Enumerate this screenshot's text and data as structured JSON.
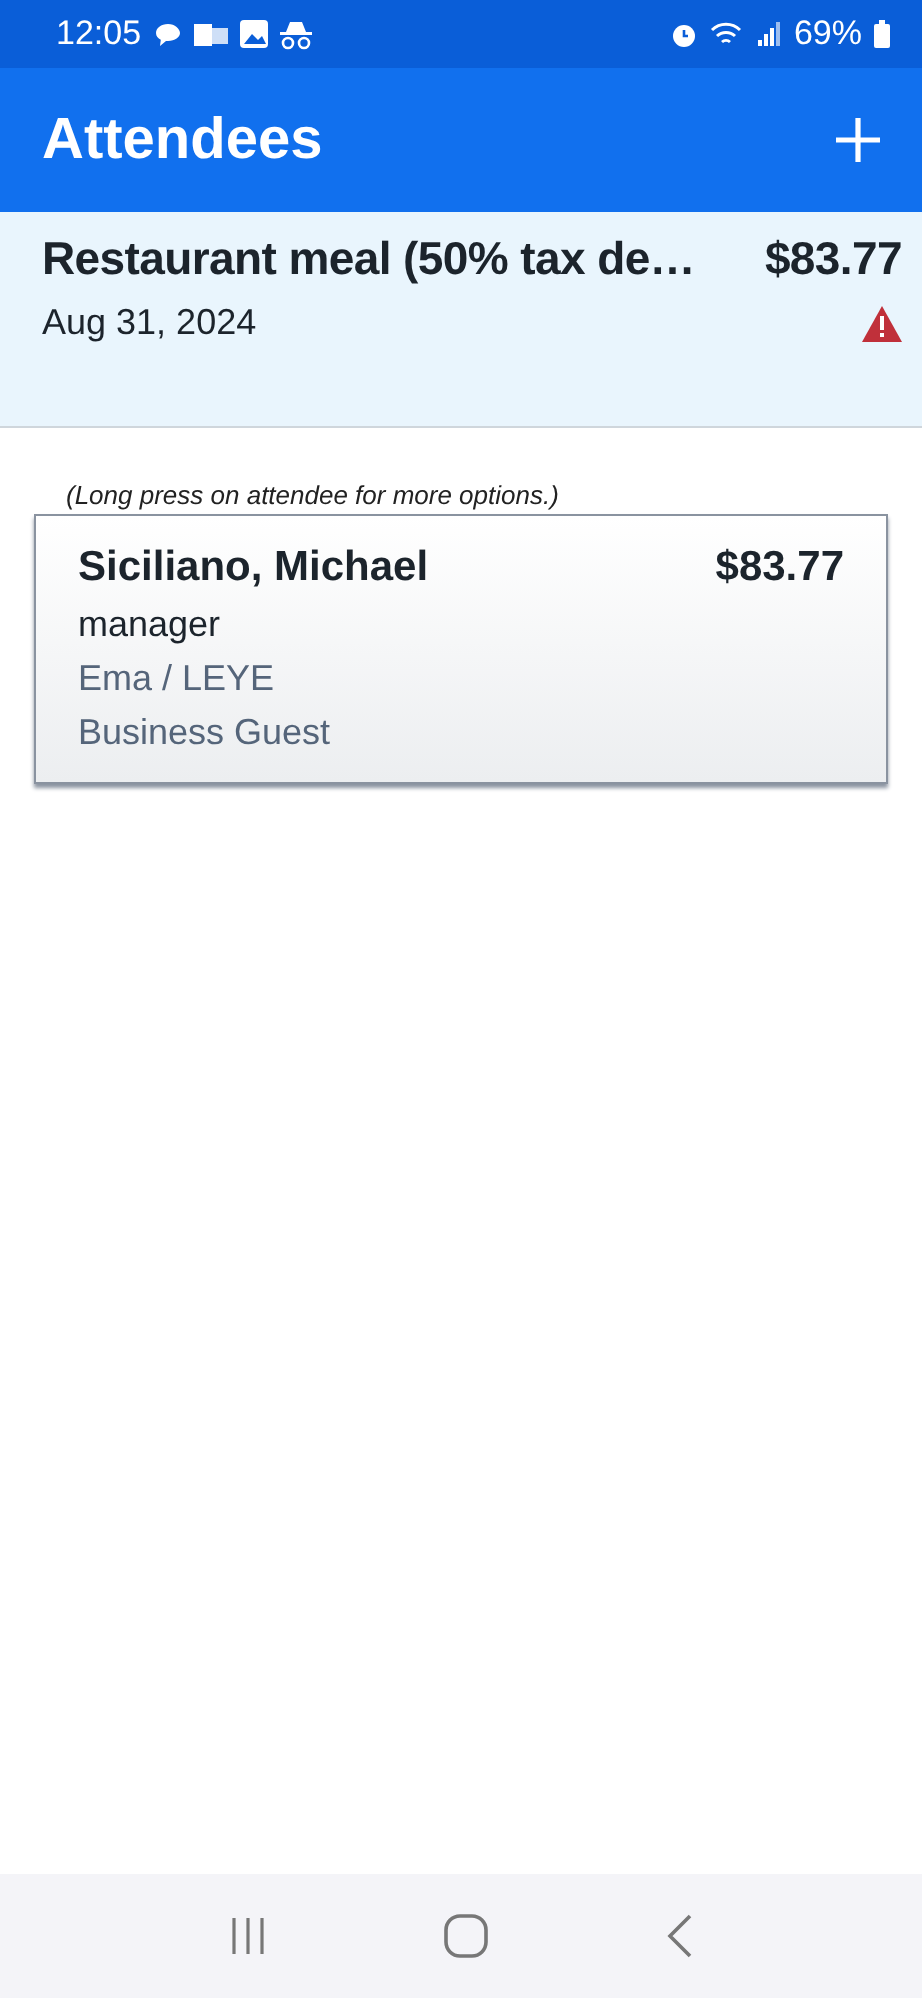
{
  "status_bar": {
    "time": "12:05",
    "battery": "69%"
  },
  "app_bar": {
    "title": "Attendees"
  },
  "expense": {
    "title": "Restaurant meal (50% tax de…",
    "amount": "$83.77",
    "date": "Aug 31, 2024",
    "warning": true
  },
  "hint": "(Long press on attendee for more options.)",
  "attendees": [
    {
      "name": "Siciliano, Michael",
      "amount": "$83.77",
      "title": "manager",
      "company": "Ema / LEYE",
      "type": "Business Guest"
    }
  ]
}
